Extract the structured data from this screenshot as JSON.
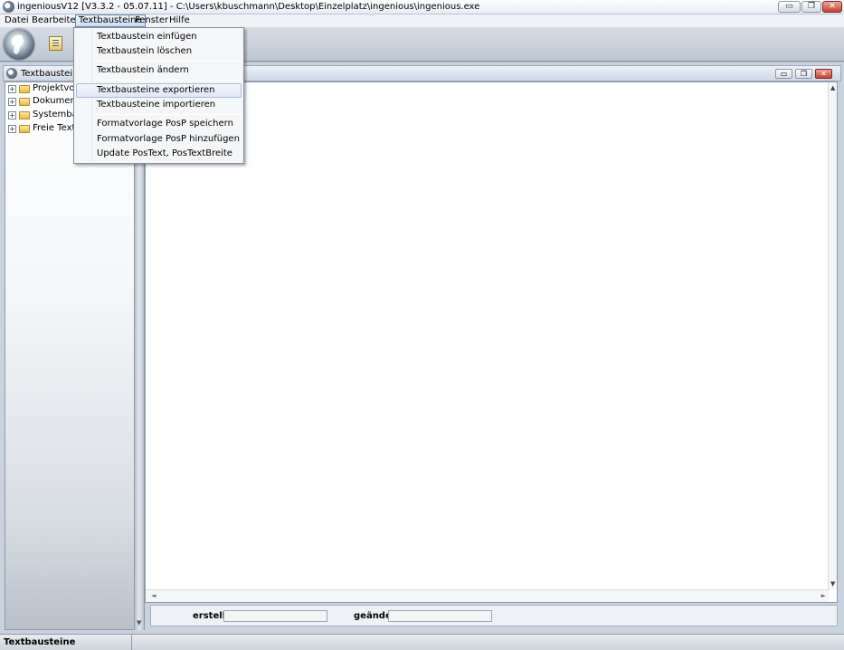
{
  "app": {
    "title": "ingeniousV12 [V3.3.2 - 05.07.11] - C:\\Users\\kbuschmann\\Desktop\\Einzelplatz\\ingenious\\ingenious.exe",
    "window_buttons": {
      "minimize": "▭",
      "maximize": "❐",
      "close": "✕"
    }
  },
  "menubar": {
    "items": [
      "Datei",
      "Bearbeiten",
      "Textbausteine",
      "Fenster",
      "Hilfe"
    ],
    "open_index": 2
  },
  "mdi": {
    "title": "Textbausteine v",
    "buttons": {
      "minimize": "▭",
      "restore": "❐",
      "close": "✕"
    }
  },
  "tree": {
    "items": [
      {
        "label": "Projektvorlag"
      },
      {
        "label": "Dokumentvo"
      },
      {
        "label": "Systembaust"
      },
      {
        "label": "Freie Texte"
      }
    ],
    "expand_glyph": "+"
  },
  "dropdown": {
    "items": [
      "Textbaustein einfügen",
      "Textbaustein löschen",
      "Textbaustein ändern",
      "Textbausteine exportieren",
      "Textbausteine importieren",
      "Formatvorlage PosP speichern",
      "Formatvorlage PosP hinzufügen",
      "Update PosText, PosTextBreite"
    ],
    "highlighted_index": 3
  },
  "infobar": {
    "created_label": "erstellt",
    "created_value": "",
    "changed_label": "geändert",
    "changed_value": ""
  },
  "statusbar": {
    "text": "Textbausteine"
  }
}
